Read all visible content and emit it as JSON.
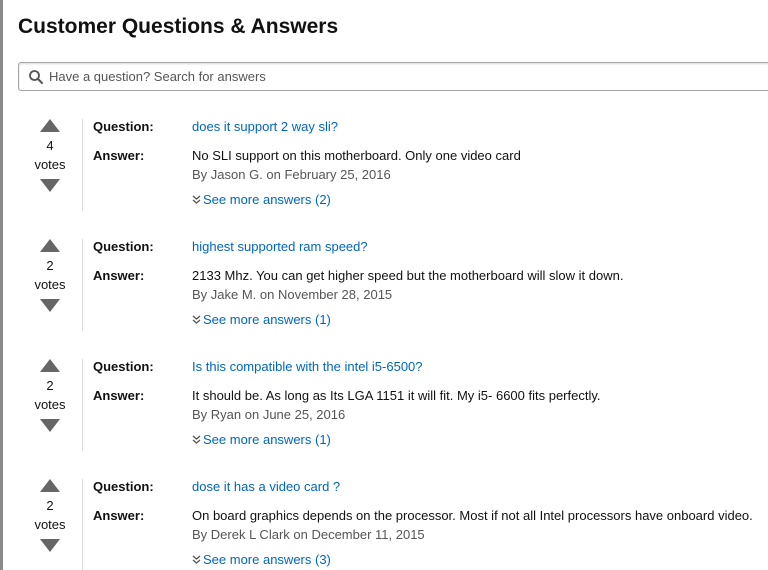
{
  "header": {
    "title": "Customer Questions & Answers"
  },
  "search": {
    "placeholder": "Have a question? Search for answers"
  },
  "labels": {
    "question": "Question:",
    "answer": "Answer:",
    "votes": "votes"
  },
  "items": [
    {
      "votes": "4",
      "question": "does it support 2 way sli?",
      "answer": "No SLI support on this motherboard. Only one video card",
      "byline": "By Jason G. on February 25, 2016",
      "more": "See more answers (2)"
    },
    {
      "votes": "2",
      "question": "highest supported ram speed?",
      "answer": "2133 Mhz. You can get higher speed but the motherboard will slow it down.",
      "byline": "By Jake M. on November 28, 2015",
      "more": "See more answers (1)"
    },
    {
      "votes": "2",
      "question": "Is this compatible with the intel i5-6500?",
      "answer": "It should be. As long as Its LGA 1151 it will fit. My i5- 6600 fits perfectly.",
      "byline": "By Ryan on June 25, 2016",
      "more": "See more answers (1)"
    },
    {
      "votes": "2",
      "question": "dose it has a video card ?",
      "answer": "On board graphics depends on the processor. Most if not all Intel processors have onboard video.",
      "byline": "By Derek L Clark on December 11, 2015",
      "more": "See more answers (3)"
    }
  ]
}
